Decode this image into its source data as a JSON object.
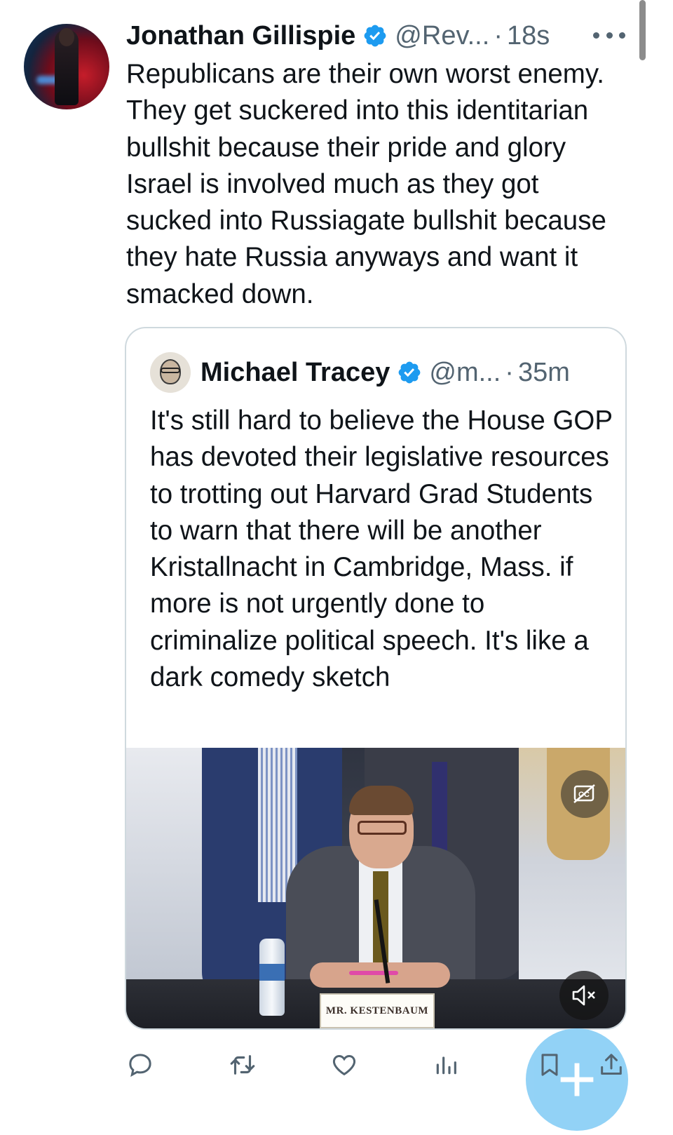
{
  "tweet": {
    "author_name": "Jonathan Gillispie",
    "handle": "@Rev...",
    "separator": "·",
    "time": "18s",
    "text": "Republicans are their own worst enemy. They get suckered into this identitarian bullshit because their pride and glory Israel is involved much as they got sucked into Russiagate bullshit because they hate Russia anyways and want it smacked down."
  },
  "quoted_tweet": {
    "author_name": "Michael Tracey",
    "handle": "@m...",
    "separator": "·",
    "time": "35m",
    "text": "It's still hard to believe the House GOP has devoted their legislative resources to trotting out Harvard Grad Students to warn that there will be another Kristallnacht in Cambridge, Mass. if more is not urgently done to criminalize political speech. It's like a dark comedy sketch",
    "video": {
      "nameplate": "MR. KESTENBAUM"
    }
  },
  "icons": {
    "verified": "verified-badge-icon",
    "more": "more-icon",
    "captions": "captions-icon",
    "mute": "mute-icon",
    "reply": "reply-icon",
    "retweet": "retweet-icon",
    "like": "like-icon",
    "views": "views-icon",
    "bookmark": "bookmark-icon",
    "share": "share-icon",
    "compose": "compose-icon"
  },
  "colors": {
    "accent": "#1d9bf0",
    "text_primary": "#0f1419",
    "text_secondary": "#536471",
    "fab": "#8dd0f6"
  },
  "fab": {
    "symbol": "+"
  }
}
